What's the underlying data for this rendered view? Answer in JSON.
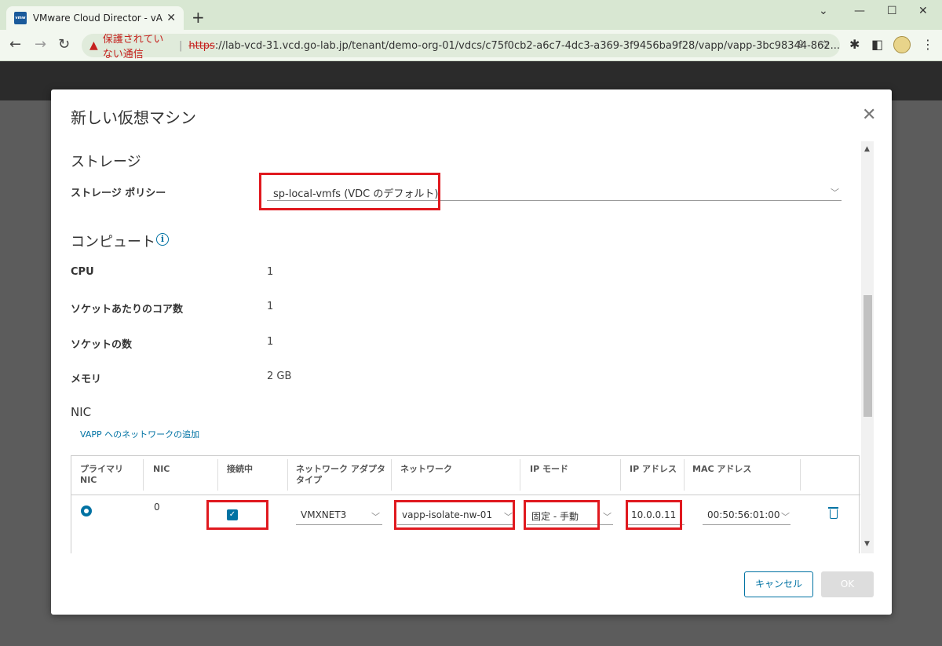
{
  "browser": {
    "tab_title": "VMware Cloud Director - vApp",
    "tab_favicon": "vmw",
    "insecure_warning": "保護されていない通信",
    "url_scheme": "https",
    "url_rest": "://lab-vcd-31.vcd.go-lab.jp/tenant/demo-org-01/vdcs/c75f0cb2-a6c7-4dc3-a369-3f9456ba9f28/vapp/vapp-3bc98344-862..."
  },
  "modal": {
    "title": "新しい仮想マシン",
    "storage": {
      "heading": "ストレージ",
      "policy_label": "ストレージ ポリシー",
      "policy_value": "sp-local-vmfs (VDC のデフォルト)"
    },
    "compute": {
      "heading": "コンピュート",
      "rows": [
        {
          "label": "CPU",
          "value": "1"
        },
        {
          "label": "ソケットあたりのコア数",
          "value": "1"
        },
        {
          "label": "ソケットの数",
          "value": "1"
        },
        {
          "label": "メモリ",
          "value": "2 GB"
        }
      ]
    },
    "nic": {
      "heading": "NIC",
      "add_link": "VAPP へのネットワークの追加",
      "columns": {
        "primary_1": "プライマリ",
        "primary_2": "NIC",
        "nic": "NIC",
        "connected": "接続中",
        "adapter_1": "ネットワーク アダプタ",
        "adapter_2": "タイプ",
        "network": "ネットワーク",
        "ip_mode": "IP モード",
        "ip_address": "IP アドレス",
        "mac": "MAC アドレス"
      },
      "row": {
        "nic_index": "0",
        "adapter_type": "VMXNET3",
        "network": "vapp-isolate-nw-01",
        "ip_mode": "固定 - 手動",
        "ip_address": "10.0.0.11",
        "mac": "00:50:56:01:00"
      }
    },
    "buttons": {
      "cancel": "キャンセル",
      "ok": "OK"
    }
  },
  "colors": {
    "accent": "#0072a3",
    "highlight": "#e0191f"
  }
}
